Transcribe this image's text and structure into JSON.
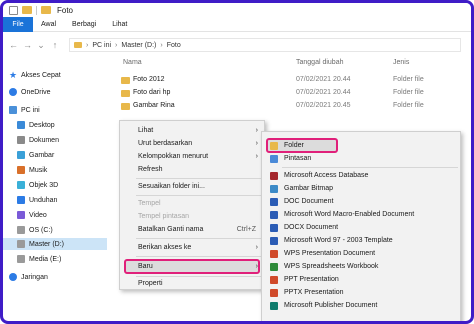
{
  "window": {
    "title": "Foto"
  },
  "ribbon": {
    "tabs": [
      "File",
      "Awal",
      "Berbagi",
      "Lihat"
    ]
  },
  "address": {
    "crumbs": [
      "PC ini",
      "Master (D:)",
      "Foto"
    ]
  },
  "nav": {
    "items": [
      {
        "label": "Akses Cepat",
        "icon": "star-icon"
      },
      {
        "label": "OneDrive",
        "icon": "cloud-icon"
      },
      {
        "label": "PC ini",
        "icon": "computer-icon"
      },
      {
        "label": "Desktop",
        "icon": "desktop-icon"
      },
      {
        "label": "Dokumen",
        "icon": "document-icon"
      },
      {
        "label": "Gambar",
        "icon": "picture-icon"
      },
      {
        "label": "Musik",
        "icon": "music-icon"
      },
      {
        "label": "Objek 3D",
        "icon": "cube-icon"
      },
      {
        "label": "Unduhan",
        "icon": "download-icon"
      },
      {
        "label": "Video",
        "icon": "video-icon"
      },
      {
        "label": "OS (C:)",
        "icon": "drive-icon"
      },
      {
        "label": "Master (D:)",
        "icon": "drive-icon"
      },
      {
        "label": "Media (E:)",
        "icon": "drive-icon"
      },
      {
        "label": "Jaringan",
        "icon": "network-icon"
      }
    ]
  },
  "filelist": {
    "headers": {
      "name": "Nama",
      "date": "Tanggal diubah",
      "type": "Jenis"
    },
    "rows": [
      {
        "name": "Foto 2012",
        "date": "07/02/2021 20.44",
        "type": "Folder file"
      },
      {
        "name": "Foto dari hp",
        "date": "07/02/2021 20.44",
        "type": "Folder file"
      },
      {
        "name": "Gambar Rina",
        "date": "07/02/2021 20.45",
        "type": "Folder file"
      }
    ]
  },
  "context_menu": {
    "items": [
      {
        "label": "Lihat",
        "arrow": "›"
      },
      {
        "label": "Urut berdasarkan",
        "arrow": "›"
      },
      {
        "label": "Kelompokkan menurut",
        "arrow": "›"
      },
      {
        "label": "Refresh"
      },
      {
        "label": "Sesuaikan folder ini..."
      },
      {
        "label": "Tempel"
      },
      {
        "label": "Tempel pintasan"
      },
      {
        "label": "Batalkan Ganti nama",
        "shortcut": "Ctrl+Z"
      },
      {
        "label": "Berikan akses ke",
        "arrow": "›"
      },
      {
        "label": "Baru",
        "arrow": "›"
      },
      {
        "label": "Properti"
      }
    ]
  },
  "submenu": {
    "items": [
      {
        "label": "Folder",
        "icon": "folder-icon",
        "color": "#e8b84a"
      },
      {
        "label": "Pintasan",
        "icon": "shortcut-icon",
        "color": "#4a8ad8"
      },
      {
        "label": "Microsoft Access Database",
        "icon": "access-icon",
        "color": "#a4262c"
      },
      {
        "label": "Gambar Bitmap",
        "icon": "bitmap-icon",
        "color": "#3c8ac7"
      },
      {
        "label": "DOC Document",
        "icon": "doc-icon",
        "color": "#2b5cb5"
      },
      {
        "label": "Microsoft Word Macro-Enabled Document",
        "icon": "word-macro-icon",
        "color": "#2b5cb5"
      },
      {
        "label": "DOCX Document",
        "icon": "docx-icon",
        "color": "#2b5cb5"
      },
      {
        "label": "Microsoft Word 97 - 2003 Template",
        "icon": "word-template-icon",
        "color": "#2b5cb5"
      },
      {
        "label": "WPS Presentation Document",
        "icon": "wps-presentation-icon",
        "color": "#d04a2a"
      },
      {
        "label": "WPS Spreadsheets Workbook",
        "icon": "wps-spreadsheet-icon",
        "color": "#2e8b3a"
      },
      {
        "label": "PPT Presentation",
        "icon": "ppt-icon",
        "color": "#d04a2a"
      },
      {
        "label": "PPTX Presentation",
        "icon": "pptx-icon",
        "color": "#d04a2a"
      },
      {
        "label": "Microsoft Publisher Document",
        "icon": "publisher-icon",
        "color": "#0f7b6c"
      }
    ]
  }
}
